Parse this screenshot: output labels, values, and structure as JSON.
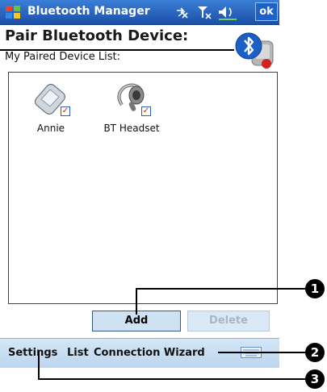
{
  "window": {
    "app_title": "Bluetooth Manager",
    "ok_label": "ok",
    "tray_icons": [
      "connectivity-icon",
      "signal-icon",
      "volume-icon"
    ]
  },
  "header": {
    "title": "Pair Bluetooth Device:",
    "subtitle": "My Paired Device List:",
    "logo_icon": "bluetooth-icon"
  },
  "devices": [
    {
      "label": "Annie",
      "icon": "pda-icon",
      "checked": true
    },
    {
      "label": "BT Headset",
      "icon": "headset-icon",
      "checked": true
    }
  ],
  "actions": {
    "add_label": "Add",
    "delete_label": "Delete"
  },
  "menubar": {
    "settings_label": "Settings",
    "list_label": "List",
    "wizard_label": "Connection Wizard",
    "keyboard_icon": "keyboard-icon"
  },
  "callouts": {
    "one": "1",
    "two": "2",
    "three": "3"
  },
  "colors": {
    "titlebar": "#1c4fa8",
    "menubar": "#c8def3",
    "button_fill": "#cfe2f3",
    "check_red": "#d01818"
  }
}
